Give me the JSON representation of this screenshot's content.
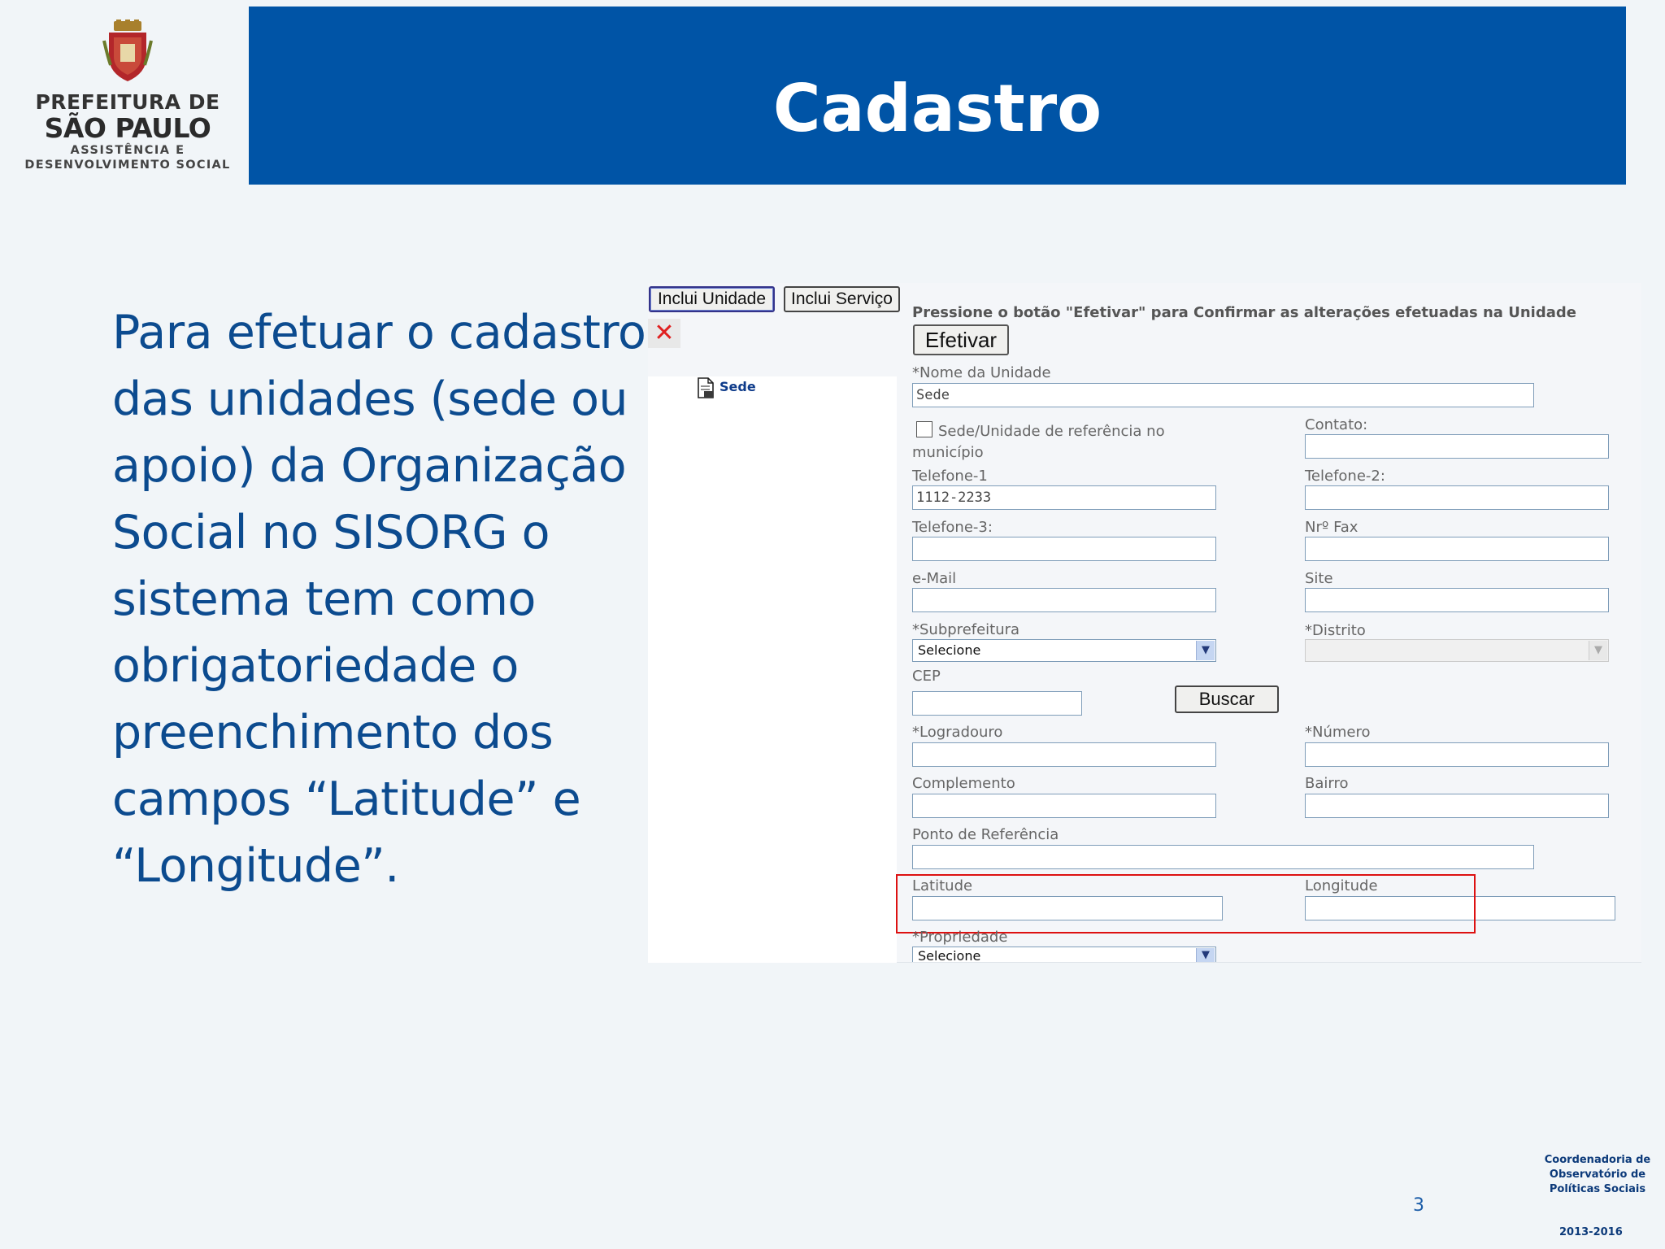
{
  "header": {
    "logo": {
      "line1": "PREFEITURA DE",
      "line2": "SÃO PAULO",
      "line3": "ASSISTÊNCIA E",
      "line4": "DESENVOLVIMENTO SOCIAL"
    },
    "title": "Cadastro"
  },
  "body_text": {
    "lines": [
      "Para efetuar o cadastro",
      "das unidades (sede ou",
      "apoio) da Organização",
      "Social no SISORG o",
      "sistema tem como",
      "obrigatoriedade o",
      "preenchimento dos",
      "campos “Latitude” e",
      "“Longitude”."
    ]
  },
  "screenshot": {
    "toolbar": {
      "inclui_unidade": "Inclui Unidade",
      "inclui_servico": "Inclui Serviço",
      "close_glyph": "✕"
    },
    "tree": {
      "sede_label": "Sede"
    },
    "hint": "Pressione o botão \"Efetivar\" para Confirmar as alterações efetuadas na Unidade",
    "efetivar": "Efetivar",
    "form": {
      "nome_label": "*Nome da Unidade",
      "nome_value": "Sede",
      "sede_ref_label_1": "Sede/Unidade de referência no",
      "sede_ref_label_2": "município",
      "contato_label": "Contato:",
      "tel1_label": "Telefone-1",
      "tel1_value": "1112-2233",
      "tel2_label": "Telefone-2:",
      "tel3_label": "Telefone-3:",
      "fax_label": "Nrº Fax",
      "email_label": "e-Mail",
      "site_label": "Site",
      "subprefeitura_label": "*Subprefeitura",
      "subprefeitura_value": "Selecione",
      "distrito_label": "*Distrito",
      "cep_label": "CEP",
      "buscar": "Buscar",
      "logradouro_label": "*Logradouro",
      "numero_label": "*Número",
      "complemento_label": "Complemento",
      "bairro_label": "Bairro",
      "ponto_label": "Ponto de Referência",
      "latitude_label": "Latitude",
      "longitude_label": "Longitude",
      "propriedade_label": "*Propriedade",
      "propriedade_value": "Selecione"
    }
  },
  "footer": {
    "page_number": "3",
    "coord_line1": "Coordenadoria de",
    "coord_line2": "Observatório de",
    "coord_line3": "Políticas Sociais",
    "years": "2013-2016"
  },
  "colors": {
    "banner": "#0054a6",
    "body_text": "#0c4b8f",
    "highlight_box": "#dd1111",
    "background": "#f1f5f8"
  }
}
